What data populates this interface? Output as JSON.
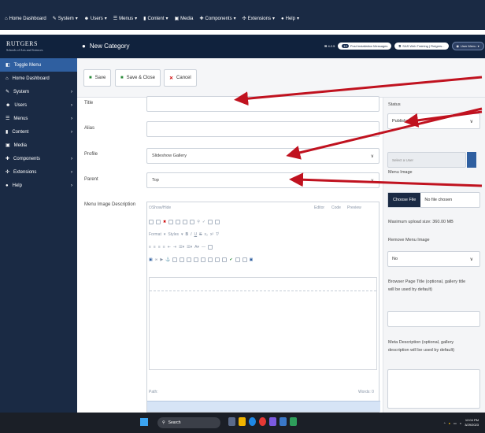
{
  "topbar": {
    "items": [
      "Home Dashboard",
      "System",
      "Users",
      "Menus",
      "Content",
      "Media",
      "Components",
      "Extensions",
      "Help"
    ]
  },
  "header": {
    "logo_line1": "RUTGERS",
    "logo_line2": "Schools of Arts and Sciences",
    "page_title": "New Category",
    "version": "4.2.5",
    "post_install_count": "12",
    "post_install_label": "Post Installation Messages",
    "site_label": "SAS Web Training | Rutgers...",
    "user_menu": "User Menu"
  },
  "sidebar": {
    "items": [
      {
        "label": "Toggle Menu",
        "icon": "toggle-icon"
      },
      {
        "label": "Home Dashboard",
        "icon": "home-icon"
      },
      {
        "label": "System",
        "icon": "wrench-icon"
      },
      {
        "label": "Users",
        "icon": "users-icon"
      },
      {
        "label": "Menus",
        "icon": "list-icon"
      },
      {
        "label": "Content",
        "icon": "file-icon"
      },
      {
        "label": "Media",
        "icon": "image-icon"
      },
      {
        "label": "Components",
        "icon": "puzzle-icon"
      },
      {
        "label": "Extensions",
        "icon": "cubes-icon"
      },
      {
        "label": "Help",
        "icon": "info-icon"
      }
    ]
  },
  "toolbar": {
    "save": "Save",
    "save_close": "Save & Close",
    "cancel": "Cancel"
  },
  "form": {
    "title_label": "Title",
    "title_value": "",
    "alias_label": "Alias",
    "alias_value": "",
    "profile_label": "Profile",
    "profile_value": "Slideshow Gallery",
    "parent_label": "Parent",
    "parent_value": "Top",
    "menu_image_desc_label": "Menu Image Description"
  },
  "editor": {
    "toggle": "Show/Hide",
    "tabs": [
      "Editor",
      "Code",
      "Preview"
    ],
    "format": "Format",
    "styles": "Styles",
    "path": "Path:",
    "words": "Words: 0"
  },
  "right": {
    "status_label": "Status",
    "status_value": "Published",
    "created_by_placeholder": "Select a User",
    "menu_image_label": "Menu Image",
    "choose_file": "Choose File",
    "no_file": "No file chosen",
    "max_upload": "Maximum upload size: 360.00 MB",
    "remove_label": "Remove Menu Image",
    "remove_value": "No",
    "browser_title_label": "Browser Page Title (optional, gallery title will be used by default)",
    "meta_desc_label": "Meta Description (optional, gallery description will be used by default)"
  },
  "taskbar": {
    "search": "Search",
    "time": "12:04 PM",
    "date": "3/29/2023"
  },
  "colors": {
    "topbar": "#1a2a44",
    "accent": "#2f5fa0",
    "arrow": "#c0121f",
    "save_green": "#2a8a3a"
  }
}
